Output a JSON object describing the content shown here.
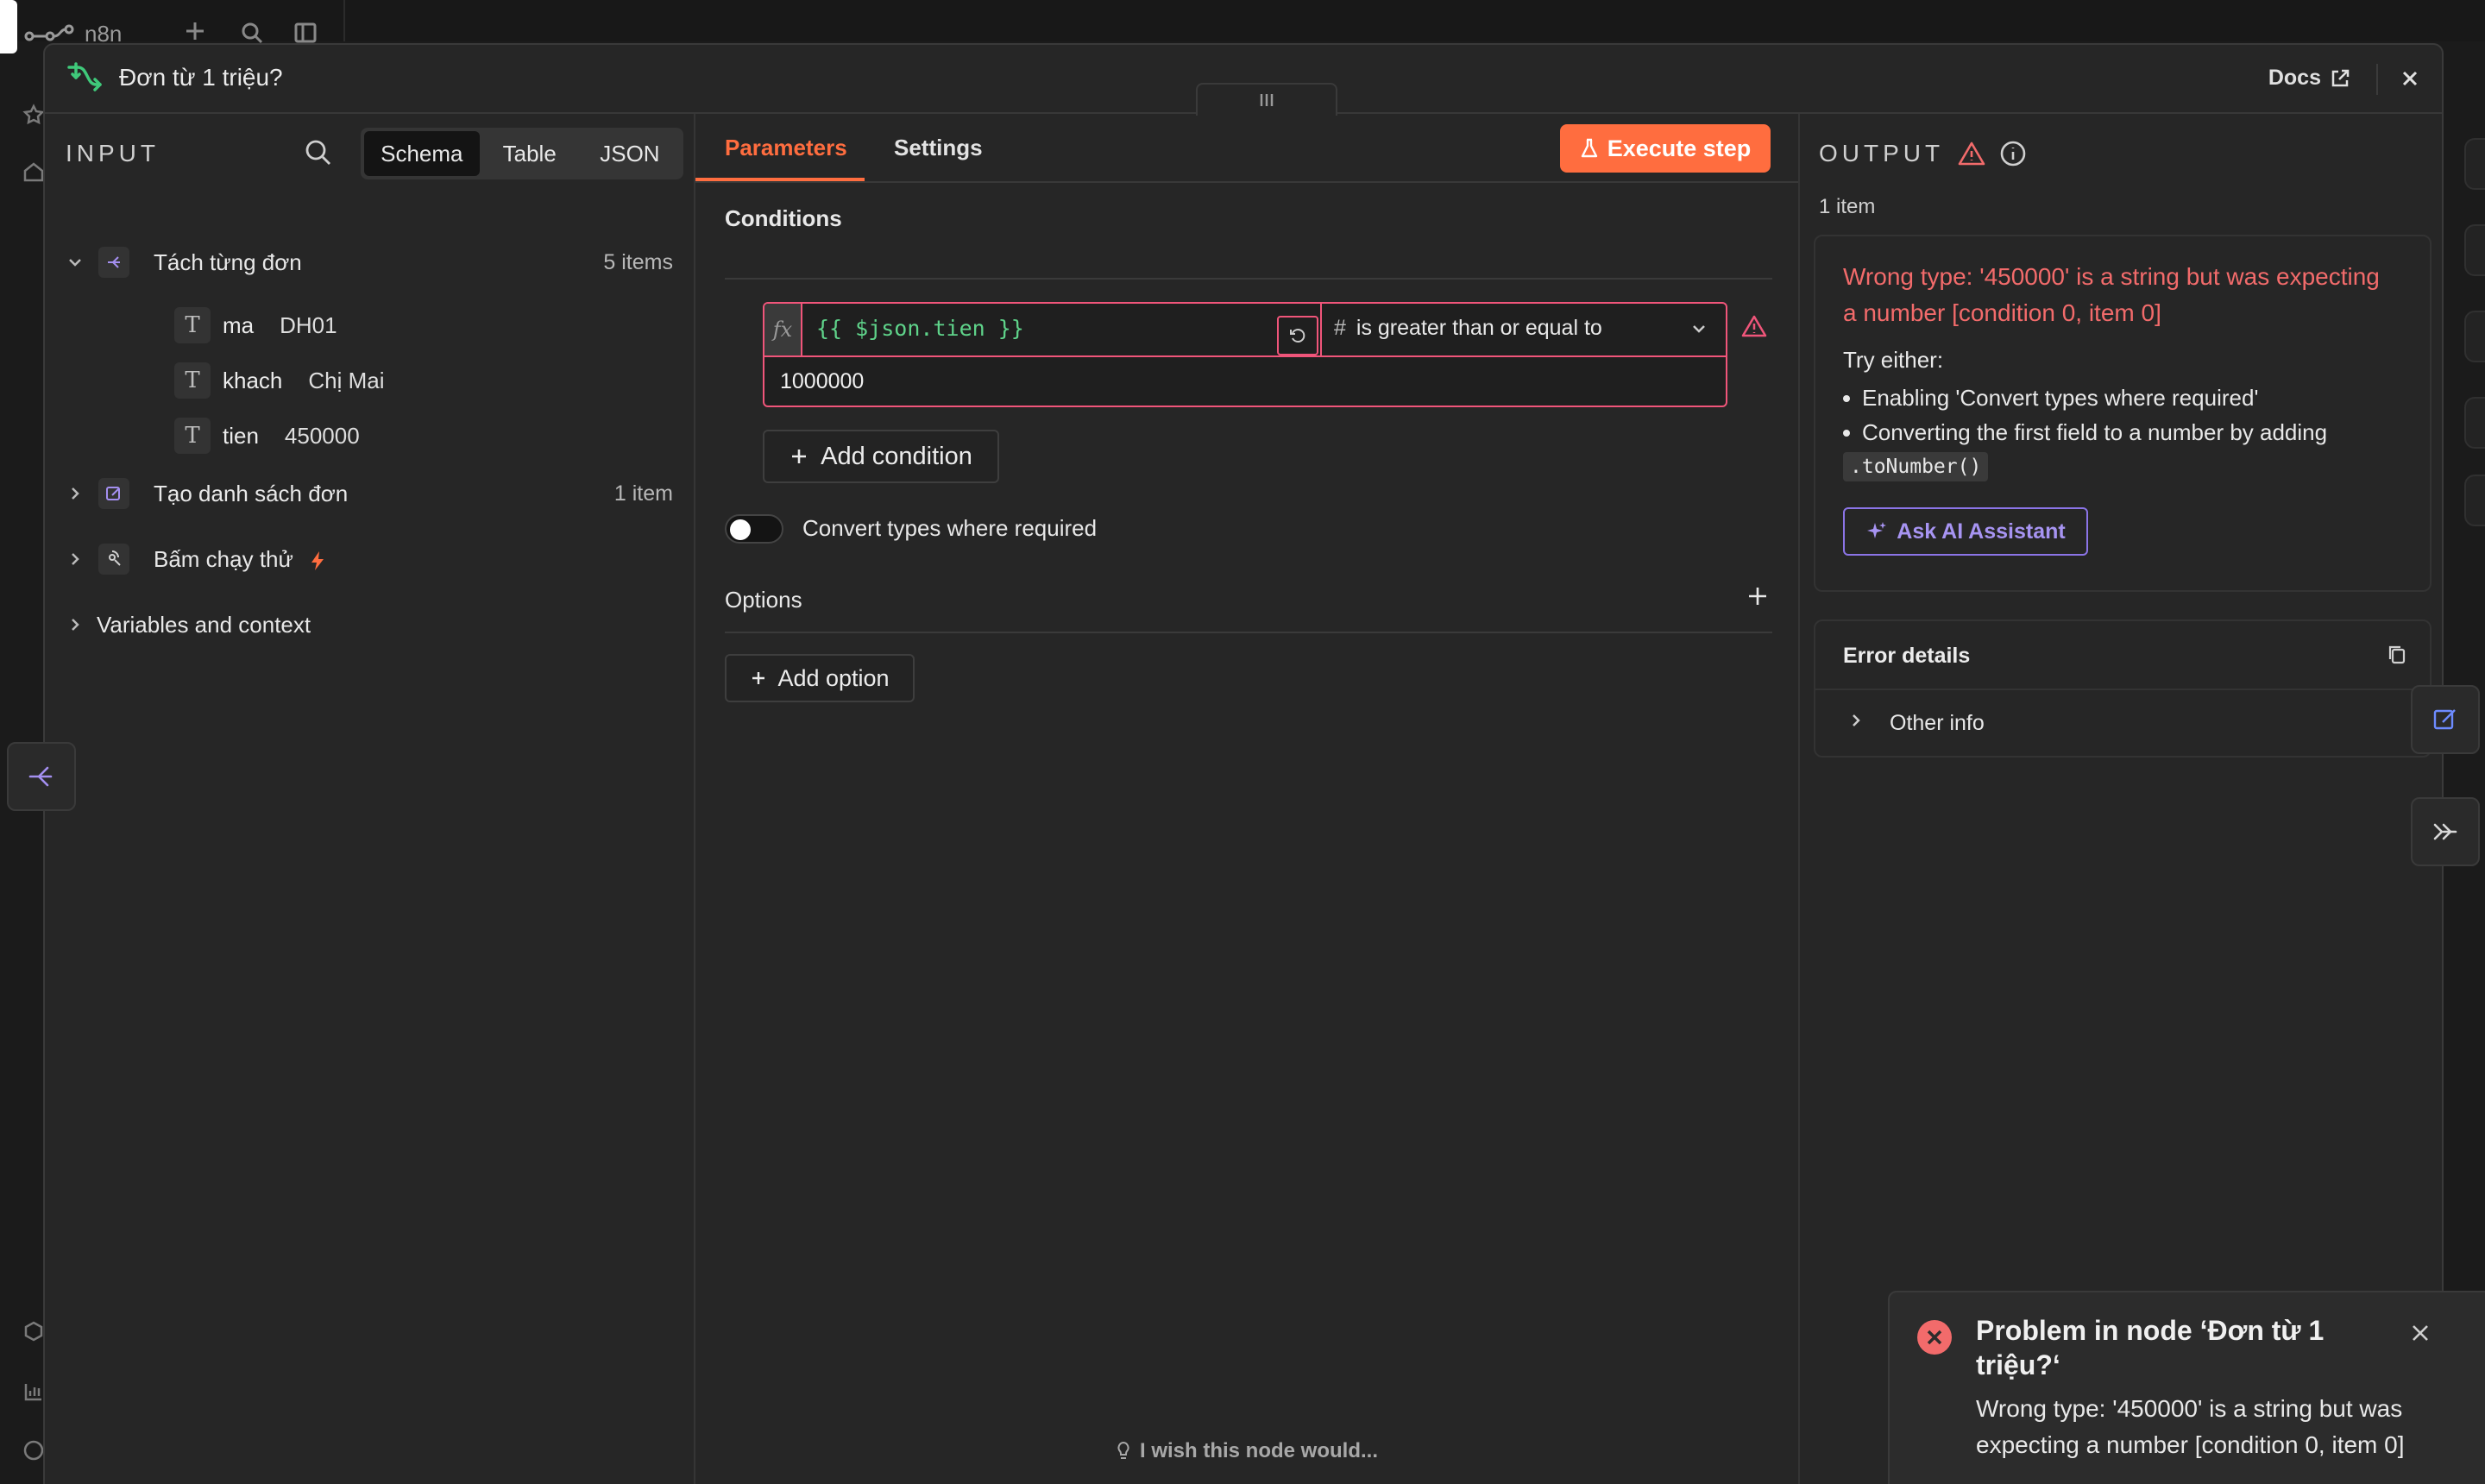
{
  "background": {
    "brand": "n8n"
  },
  "header": {
    "node_title": "Đơn từ 1 triệu?",
    "docs_label": "Docs"
  },
  "input": {
    "label": "INPUT",
    "views": [
      "Schema",
      "Table",
      "JSON"
    ],
    "active_view": "Schema",
    "nodes": [
      {
        "name": "Tách từng đơn",
        "count": "5 items",
        "expanded": true,
        "fields": [
          {
            "type": "T",
            "key": "ma",
            "value": "DH01"
          },
          {
            "type": "T",
            "key": "khach",
            "value": "Chị Mai"
          },
          {
            "type": "T",
            "key": "tien",
            "value": "450000"
          }
        ]
      },
      {
        "name": "Tạo danh sách đơn",
        "count": "1 item"
      },
      {
        "name": "Bấm chạy thử",
        "count": ""
      }
    ],
    "variables_label": "Variables and context"
  },
  "params": {
    "tabs": [
      "Parameters",
      "Settings"
    ],
    "active_tab": "Parameters",
    "execute_label": "Execute step",
    "conditions_label": "Conditions",
    "fx_label": "fx",
    "left_value": "{{ $json.tien }}",
    "operator_type_icon": "#",
    "operator": "is greater than or equal to",
    "right_value": "1000000",
    "add_condition_label": "Add condition",
    "convert_types_label": "Convert types where required",
    "convert_types_on": false,
    "options_label": "Options",
    "add_option_label": "Add option",
    "wish_label": "I wish this node would..."
  },
  "output": {
    "label": "OUTPUT",
    "item_count": "1 item",
    "error_title": "Wrong type: '450000' is a string but was expecting a number [condition 0, item 0]",
    "try_either": "Try either:",
    "bullets": [
      "Enabling 'Convert types where required'",
      "Converting the first field to a number by adding"
    ],
    "code_hint": ".toNumber()",
    "ask_ai_label": "Ask AI Assistant",
    "error_details_label": "Error details",
    "other_info_label": "Other info"
  },
  "toast": {
    "title": "Problem in node ‘Đơn từ 1 triệu?‘",
    "message": "Wrong type: '450000' is a string but was expecting a number [condition 0, item 0]"
  },
  "colors": {
    "accent": "#ff6d3f",
    "error": "#f26b6b",
    "invalid_border": "#f0557a",
    "ai": "#8b74e6",
    "expression": "#5fd38a",
    "node_green": "#3fc97a",
    "sub_node": "#a48ff0"
  }
}
